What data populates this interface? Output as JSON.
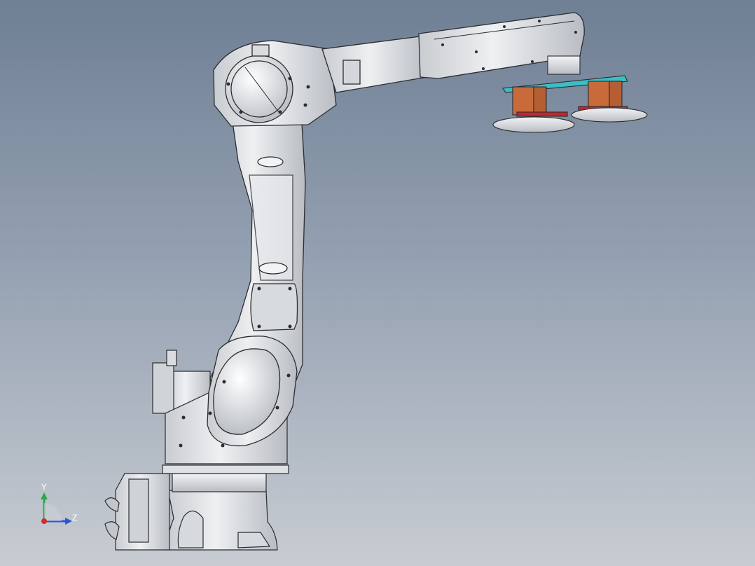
{
  "viewport": {
    "background_top": "#6f7f94",
    "background_bottom": "#c8ccd2",
    "model": {
      "body_color": "#e3e5e8",
      "edge_color": "#2b2d30",
      "gripper_plate_color": "#3bbfc4",
      "gripper_block_color": "#c86a3a",
      "gripper_accent_color": "#c1272d"
    }
  },
  "triad": {
    "labels": {
      "y": "Y",
      "z": "Z"
    },
    "colors": {
      "y": "#2fa64a",
      "z": "#2b57d6",
      "x": "#d22b2b"
    }
  }
}
